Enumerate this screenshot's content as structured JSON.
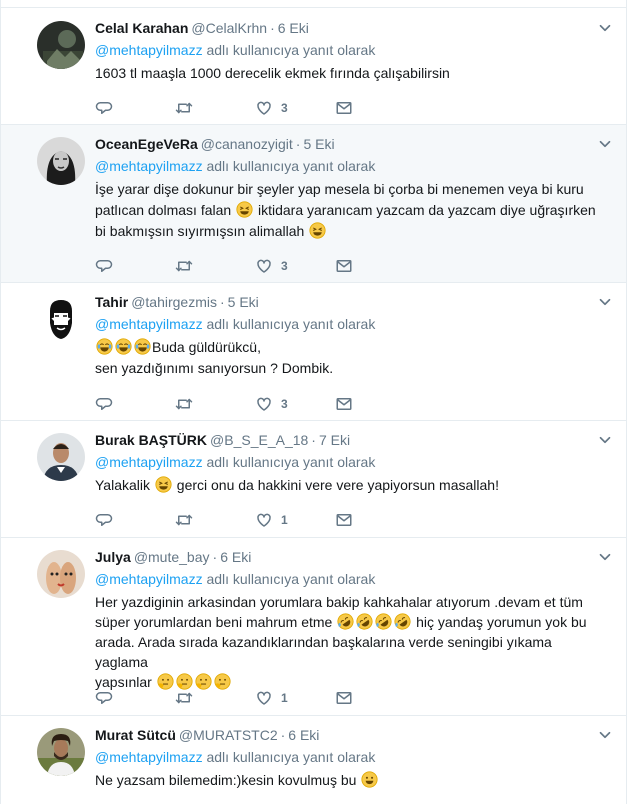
{
  "reply_to_text": "adlı kullanıcıya yanıt olarak",
  "tweets": [
    {
      "name": "Celal Karahan",
      "handle": "@CelalKrhn",
      "time": "6 Eki",
      "mention": "@mehtapyilmazz",
      "lines": [
        "1603 tl maaşla 1000 derecelik ekmek fırında çalışabilirsin"
      ],
      "likes": "3",
      "highlighted": false
    },
    {
      "name": "OceanEgeVeRa",
      "handle": "@cananozyigit",
      "time": "5 Eki",
      "mention": "@mehtapyilmazz",
      "lines": [
        "İşe yarar dişe dokunur bir şeyler yap mesela bi çorba bi menemen veya bi kuru",
        "patlıcan dolması falan",
        "iktidara yaranıcam yazcam da yazcam diye uğraşırken",
        "bi bakmışsın sıyırmışsın alimallah"
      ],
      "likes": "3",
      "highlighted": true
    },
    {
      "name": "Tahir",
      "handle": "@tahirgezmis",
      "time": "5 Eki",
      "mention": "@mehtapyilmazz",
      "lines": [
        "Buda güldürükcü,",
        "sen yazdığınımı sanıyorsun ? Dombik."
      ],
      "likes": "3",
      "highlighted": false
    },
    {
      "name": "Burak BAŞTÜRK",
      "handle": "@B_S_E_A_18",
      "time": "7 Eki",
      "mention": "@mehtapyilmazz",
      "lines": [
        "Yalakalik",
        "gerci onu da hakkini vere vere yapiyorsun masallah!"
      ],
      "likes": "1",
      "highlighted": false
    },
    {
      "name": "Julya",
      "handle": "@mute_bay",
      "time": "6 Eki",
      "mention": "@mehtapyilmazz",
      "lines": [
        "Her yazdiginin arkasindan yorumlara bakip kahkahalar atıyorum .devam et tüm",
        "süper yorumlardan beni mahrum etme",
        "hiç yandaş yorumun yok bu",
        "arada. Arada sırada kazandıklarından başkalarına verde seningibi yıkama yaglama",
        "yapsınlar"
      ],
      "likes": "1",
      "highlighted": false
    },
    {
      "name": "Murat Sütcü",
      "handle": "@MURATSTC2",
      "time": "6 Eki",
      "mention": "@mehtapyilmazz",
      "lines": [
        "Ne yazsam bilemedim:)kesin kovulmuş bu"
      ],
      "likes": "",
      "highlighted": false
    }
  ],
  "colors": {
    "link": "#1da1f2",
    "muted": "#657786",
    "text": "#14171a",
    "highlight_bg": "#f5f8fa",
    "divider": "#e6ecf0"
  },
  "icons": {
    "reply": "reply-icon",
    "retweet": "retweet-icon",
    "like": "heart-icon",
    "dm": "envelope-icon",
    "menu": "chevron-down-icon"
  }
}
